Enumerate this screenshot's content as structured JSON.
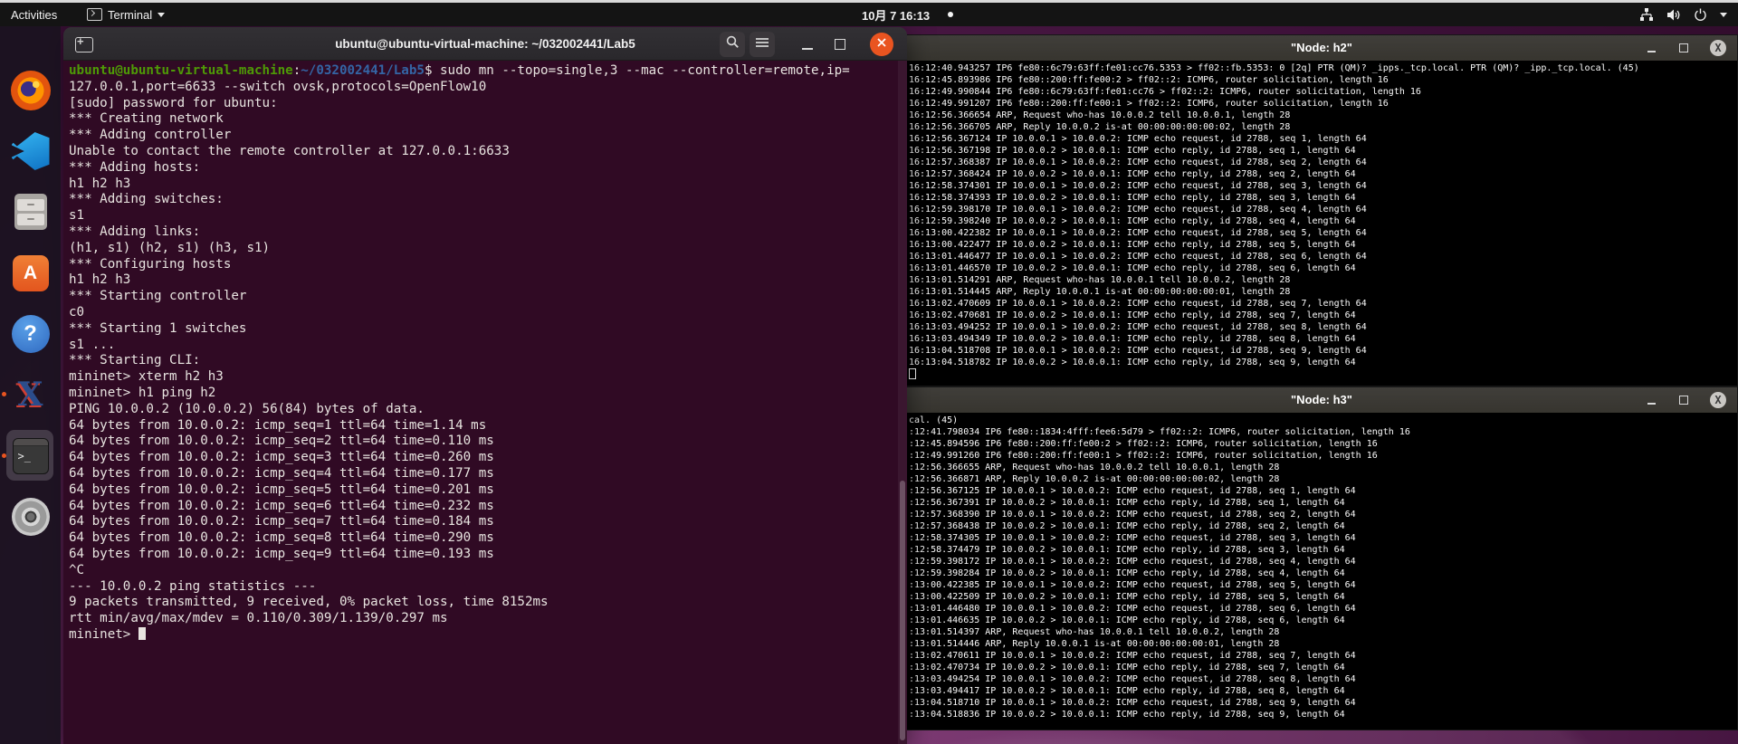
{
  "top_bar": {
    "activities_label": "Activities",
    "app_menu_label": "Terminal",
    "clock": "10月 7 16:13",
    "tray_icons": [
      "network-wired",
      "volume",
      "power",
      "chevron-down"
    ],
    "has_notification_dot": true
  },
  "dock": {
    "items": [
      "firefox",
      "vscode",
      "files",
      "ubuntu-software",
      "help",
      "xterm",
      "terminal",
      "dvd"
    ],
    "active_item": "terminal",
    "running_items": [
      "xterm",
      "terminal"
    ],
    "indicator_color": "#e95420"
  },
  "colors": {
    "terminal_background": "#300a24",
    "prompt_green": "#4e9a06",
    "path_blue": "#3465a4",
    "close_button_orange": "#e95420",
    "xterm_background": "#000000",
    "desktop_purple": "#5d2455"
  },
  "terminal_window": {
    "title": "ubuntu@ubuntu-virtual-machine: ~/032002441/Lab5",
    "lines": [
      {
        "segments": [
          {
            "text": "ubuntu@ubuntu-virtual-machine",
            "style": "green"
          },
          {
            "text": ":"
          },
          {
            "text": "~/032002441/Lab5",
            "style": "blue"
          },
          {
            "text": "$ sudo mn --topo=single,3 --mac --controller=remote,ip="
          }
        ]
      },
      "127.0.0.1,port=6633 --switch ovsk,protocols=OpenFlow10",
      "[sudo] password for ubuntu:",
      "*** Creating network",
      "*** Adding controller",
      "Unable to contact the remote controller at 127.0.0.1:6633",
      "*** Adding hosts:",
      "h1 h2 h3",
      "*** Adding switches:",
      "s1",
      "*** Adding links:",
      "(h1, s1) (h2, s1) (h3, s1)",
      "*** Configuring hosts",
      "h1 h2 h3",
      "*** Starting controller",
      "c0",
      "*** Starting 1 switches",
      "s1 ...",
      "*** Starting CLI:",
      "mininet> xterm h2 h3",
      "mininet> h1 ping h2",
      "PING 10.0.0.2 (10.0.0.2) 56(84) bytes of data.",
      "64 bytes from 10.0.0.2: icmp_seq=1 ttl=64 time=1.14 ms",
      "64 bytes from 10.0.0.2: icmp_seq=2 ttl=64 time=0.110 ms",
      "64 bytes from 10.0.0.2: icmp_seq=3 ttl=64 time=0.260 ms",
      "64 bytes from 10.0.0.2: icmp_seq=4 ttl=64 time=0.177 ms",
      "64 bytes from 10.0.0.2: icmp_seq=5 ttl=64 time=0.201 ms",
      "64 bytes from 10.0.0.2: icmp_seq=6 ttl=64 time=0.232 ms",
      "64 bytes from 10.0.0.2: icmp_seq=7 ttl=64 time=0.184 ms",
      "64 bytes from 10.0.0.2: icmp_seq=8 ttl=64 time=0.290 ms",
      "64 bytes from 10.0.0.2: icmp_seq=9 ttl=64 time=0.193 ms",
      "^C",
      "--- 10.0.0.2 ping statistics ---",
      "9 packets transmitted, 9 received, 0% packet loss, time 8152ms",
      "rtt min/avg/max/mdev = 0.110/0.309/1.139/0.297 ms",
      {
        "segments": [
          {
            "text": "mininet> "
          }
        ],
        "cursor": "block"
      }
    ]
  },
  "xterm_h2": {
    "title": "\"Node: h2\"",
    "lines": [
      "16:12:40.943257 IP6 fe80::6c79:63ff:fe01:cc76.5353 > ff02::fb.5353: 0 [2q] PTR (QM)? _ipps._tcp.local. PTR (QM)? _ipp._tcp.local. (45)",
      "16:12:45.893986 IP6 fe80::200:ff:fe00:2 > ff02::2: ICMP6, router solicitation, length 16",
      "16:12:49.990844 IP6 fe80::6c79:63ff:fe01:cc76 > ff02::2: ICMP6, router solicitation, length 16",
      "16:12:49.991207 IP6 fe80::200:ff:fe00:1 > ff02::2: ICMP6, router solicitation, length 16",
      "16:12:56.366654 ARP, Request who-has 10.0.0.2 tell 10.0.0.1, length 28",
      "16:12:56.366705 ARP, Reply 10.0.0.2 is-at 00:00:00:00:00:02, length 28",
      "16:12:56.367124 IP 10.0.0.1 > 10.0.0.2: ICMP echo request, id 2788, seq 1, length 64",
      "16:12:56.367198 IP 10.0.0.2 > 10.0.0.1: ICMP echo reply, id 2788, seq 1, length 64",
      "16:12:57.368387 IP 10.0.0.1 > 10.0.0.2: ICMP echo request, id 2788, seq 2, length 64",
      "16:12:57.368424 IP 10.0.0.2 > 10.0.0.1: ICMP echo reply, id 2788, seq 2, length 64",
      "16:12:58.374301 IP 10.0.0.1 > 10.0.0.2: ICMP echo request, id 2788, seq 3, length 64",
      "16:12:58.374393 IP 10.0.0.2 > 10.0.0.1: ICMP echo reply, id 2788, seq 3, length 64",
      "16:12:59.398170 IP 10.0.0.1 > 10.0.0.2: ICMP echo request, id 2788, seq 4, length 64",
      "16:12:59.398240 IP 10.0.0.2 > 10.0.0.1: ICMP echo reply, id 2788, seq 4, length 64",
      "16:13:00.422382 IP 10.0.0.1 > 10.0.0.2: ICMP echo request, id 2788, seq 5, length 64",
      "16:13:00.422477 IP 10.0.0.2 > 10.0.0.1: ICMP echo reply, id 2788, seq 5, length 64",
      "16:13:01.446477 IP 10.0.0.1 > 10.0.0.2: ICMP echo request, id 2788, seq 6, length 64",
      "16:13:01.446570 IP 10.0.0.2 > 10.0.0.1: ICMP echo reply, id 2788, seq 6, length 64",
      "16:13:01.514291 ARP, Request who-has 10.0.0.1 tell 10.0.0.2, length 28",
      "16:13:01.514445 ARP, Reply 10.0.0.1 is-at 00:00:00:00:00:01, length 28",
      "16:13:02.470609 IP 10.0.0.1 > 10.0.0.2: ICMP echo request, id 2788, seq 7, length 64",
      "16:13:02.470681 IP 10.0.0.2 > 10.0.0.1: ICMP echo reply, id 2788, seq 7, length 64",
      "16:13:03.494252 IP 10.0.0.1 > 10.0.0.2: ICMP echo request, id 2788, seq 8, length 64",
      "16:13:03.494349 IP 10.0.0.2 > 10.0.0.1: ICMP echo reply, id 2788, seq 8, length 64",
      "16:13:04.518708 IP 10.0.0.1 > 10.0.0.2: ICMP echo request, id 2788, seq 9, length 64",
      "16:13:04.518782 IP 10.0.0.2 > 10.0.0.1: ICMP echo reply, id 2788, seq 9, length 64",
      {
        "segments": [],
        "cursor": "hollow"
      }
    ]
  },
  "xterm_h3": {
    "title": "\"Node: h3\"",
    "lines": [
      "cal. (45)",
      ":12:41.798034 IP6 fe80::1834:4fff:fee6:5d79 > ff02::2: ICMP6, router solicitation, length 16",
      ":12:45.894596 IP6 fe80::200:ff:fe00:2 > ff02::2: ICMP6, router solicitation, length 16",
      ":12:49.991260 IP6 fe80::200:ff:fe00:1 > ff02::2: ICMP6, router solicitation, length 16",
      ":12:56.366655 ARP, Request who-has 10.0.0.2 tell 10.0.0.1, length 28",
      ":12:56.366871 ARP, Reply 10.0.0.2 is-at 00:00:00:00:00:02, length 28",
      ":12:56.367125 IP 10.0.0.1 > 10.0.0.2: ICMP echo request, id 2788, seq 1, length 64",
      ":12:56.367391 IP 10.0.0.2 > 10.0.0.1: ICMP echo reply, id 2788, seq 1, length 64",
      ":12:57.368390 IP 10.0.0.1 > 10.0.0.2: ICMP echo request, id 2788, seq 2, length 64",
      ":12:57.368438 IP 10.0.0.2 > 10.0.0.1: ICMP echo reply, id 2788, seq 2, length 64",
      ":12:58.374305 IP 10.0.0.1 > 10.0.0.2: ICMP echo request, id 2788, seq 3, length 64",
      ":12:58.374479 IP 10.0.0.2 > 10.0.0.1: ICMP echo reply, id 2788, seq 3, length 64",
      ":12:59.398172 IP 10.0.0.1 > 10.0.0.2: ICMP echo request, id 2788, seq 4, length 64",
      ":12:59.398284 IP 10.0.0.2 > 10.0.0.1: ICMP echo reply, id 2788, seq 4, length 64",
      ":13:00.422385 IP 10.0.0.1 > 10.0.0.2: ICMP echo request, id 2788, seq 5, length 64",
      ":13:00.422509 IP 10.0.0.2 > 10.0.0.1: ICMP echo reply, id 2788, seq 5, length 64",
      ":13:01.446480 IP 10.0.0.1 > 10.0.0.2: ICMP echo request, id 2788, seq 6, length 64",
      ":13:01.446635 IP 10.0.0.2 > 10.0.0.1: ICMP echo reply, id 2788, seq 6, length 64",
      ":13:01.514397 ARP, Request who-has 10.0.0.1 tell 10.0.0.2, length 28",
      ":13:01.514446 ARP, Reply 10.0.0.1 is-at 00:00:00:00:00:01, length 28",
      ":13:02.470611 IP 10.0.0.1 > 10.0.0.2: ICMP echo request, id 2788, seq 7, length 64",
      ":13:02.470734 IP 10.0.0.2 > 10.0.0.1: ICMP echo reply, id 2788, seq 7, length 64",
      ":13:03.494254 IP 10.0.0.1 > 10.0.0.2: ICMP echo request, id 2788, seq 8, length 64",
      ":13:03.494417 IP 10.0.0.2 > 10.0.0.1: ICMP echo reply, id 2788, seq 8, length 64",
      ":13:04.518710 IP 10.0.0.1 > 10.0.0.2: ICMP echo request, id 2788, seq 9, length 64",
      ":13:04.518836 IP 10.0.0.2 > 10.0.0.1: ICMP echo reply, id 2788, seq 9, length 64"
    ]
  }
}
